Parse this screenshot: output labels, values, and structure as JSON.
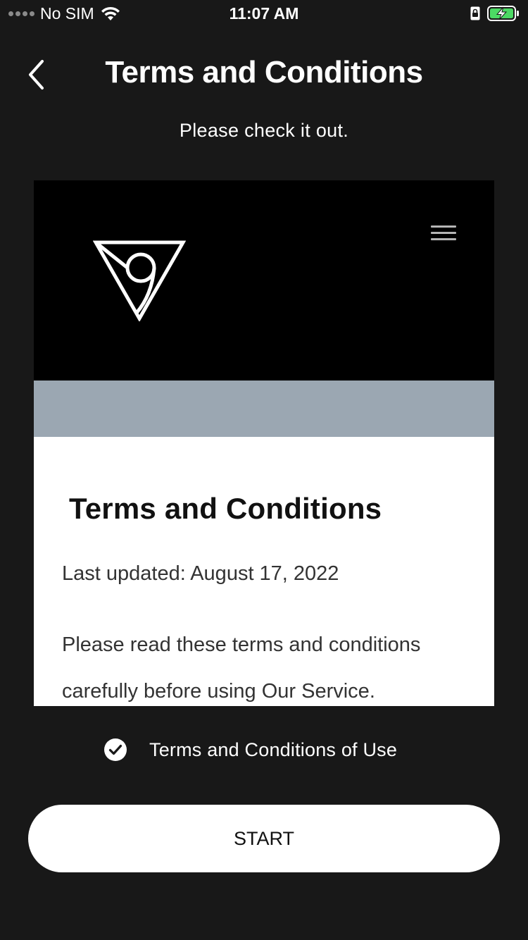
{
  "status_bar": {
    "carrier": "No SIM",
    "time": "11:07 AM",
    "icons": [
      "signal-dots-icon",
      "wifi-icon",
      "orientation-lock-icon",
      "battery-charging-icon"
    ]
  },
  "header": {
    "back_icon": "chevron-left-icon",
    "title": "Terms and Conditions",
    "subtitle": "Please check it out."
  },
  "webview": {
    "logo_icon": "triangle-nine-logo",
    "menu_icon": "hamburger-menu-icon",
    "heading": "Terms and Conditions",
    "last_updated": "Last updated: August 17, 2022",
    "paragraph": "Please read these terms and conditions carefully before using Our Service."
  },
  "agreement": {
    "checked": true,
    "label": "Terms and Conditions of Use"
  },
  "start_button": {
    "label": "START"
  },
  "colors": {
    "background": "#181818",
    "web_band": "#9ba7b2",
    "button_bg": "#ffffff"
  }
}
